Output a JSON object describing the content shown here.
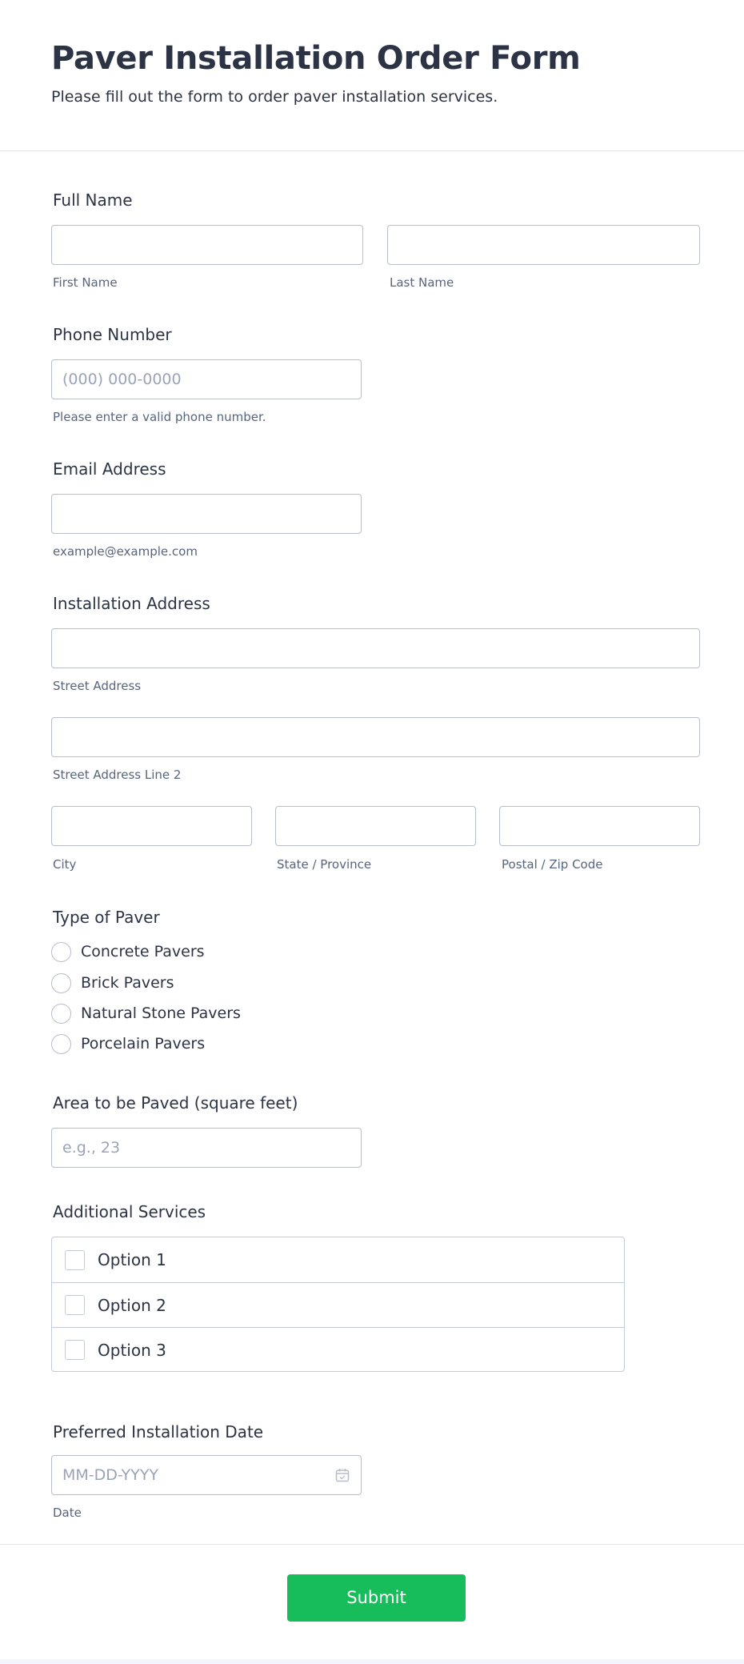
{
  "form": {
    "title": "Paver Installation Order Form",
    "subtitle": "Please fill out the form to order paver installation services."
  },
  "full_name": {
    "label": "Full Name",
    "first_sublabel": "First Name",
    "last_sublabel": "Last Name",
    "first_value": "",
    "last_value": ""
  },
  "phone": {
    "label": "Phone Number",
    "placeholder": "(000) 000-0000",
    "sublabel": "Please enter a valid phone number."
  },
  "email": {
    "label": "Email Address",
    "value": "",
    "sublabel": "example@example.com"
  },
  "address": {
    "label": "Installation Address",
    "street_sublabel": "Street Address",
    "street2_sublabel": "Street Address Line 2",
    "city_sublabel": "City",
    "state_sublabel": "State / Province",
    "zip_sublabel": "Postal / Zip Code"
  },
  "paver_type": {
    "label": "Type of Paver",
    "options": [
      "Concrete Pavers",
      "Brick Pavers",
      "Natural Stone Pavers",
      "Porcelain Pavers"
    ]
  },
  "area": {
    "label": "Area to be Paved (square feet)",
    "placeholder": "e.g., 23"
  },
  "services": {
    "label": "Additional Services",
    "options": [
      "Option 1",
      "Option 2",
      "Option 3"
    ]
  },
  "date": {
    "label": "Preferred Installation Date",
    "placeholder": "MM-DD-YYYY",
    "sublabel": "Date",
    "icon": "calendar-icon"
  },
  "submit": {
    "label": "Submit"
  },
  "colors": {
    "submit_bg": "#18bd5b",
    "text": "#2c3345",
    "border": "#b8bdc9"
  }
}
